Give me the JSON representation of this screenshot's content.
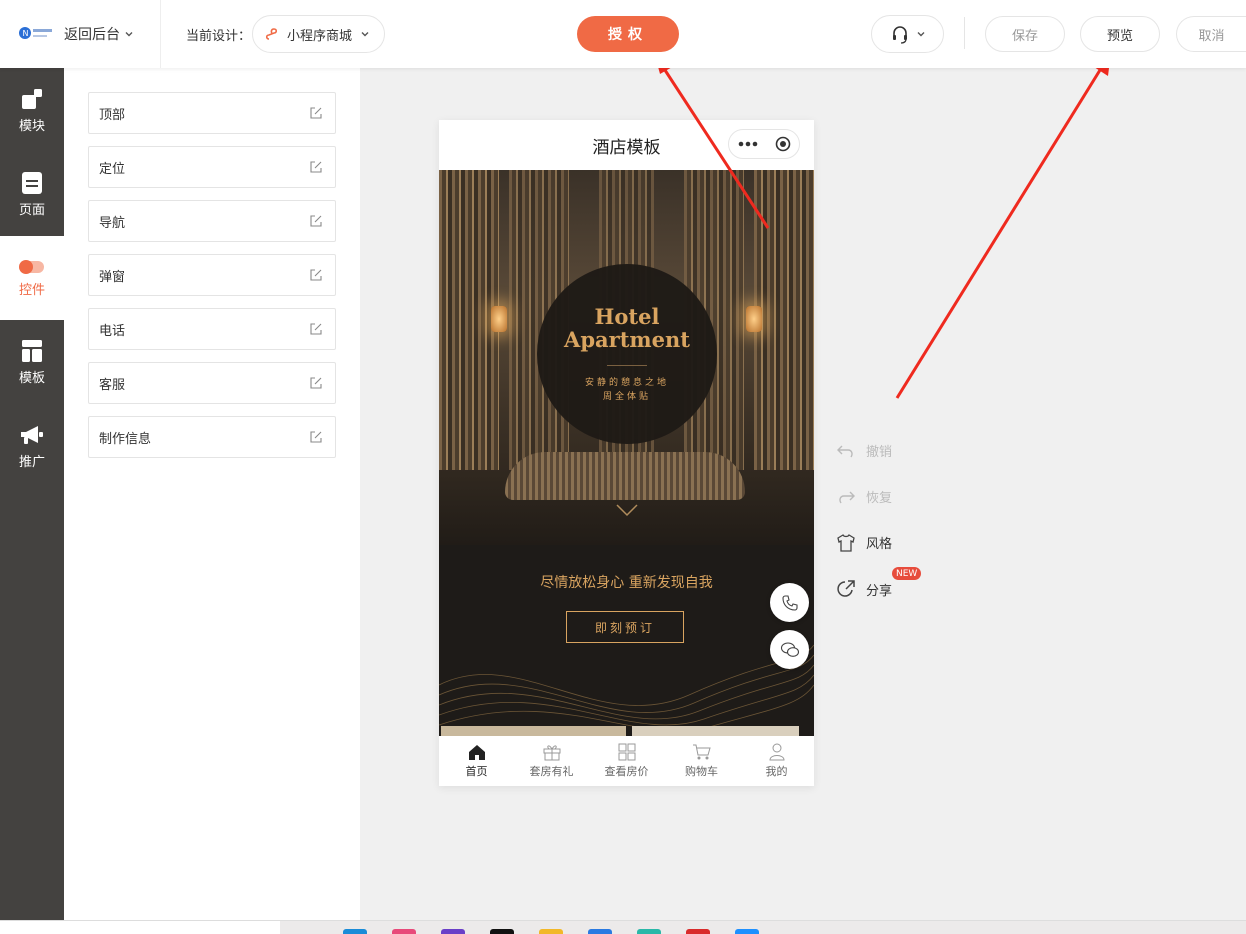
{
  "topbar": {
    "back_label": "返回后台",
    "current_design_label": "当前设计：",
    "design_name": "小程序商城",
    "auth_label": "授权",
    "save_label": "保存",
    "preview_label": "预览",
    "cancel_label": "取消"
  },
  "sidebar": {
    "items": [
      {
        "label": "模块"
      },
      {
        "label": "页面"
      },
      {
        "label": "控件"
      },
      {
        "label": "模板"
      },
      {
        "label": "推广"
      }
    ]
  },
  "controls": {
    "items": [
      {
        "label": "顶部"
      },
      {
        "label": "定位"
      },
      {
        "label": "导航"
      },
      {
        "label": "弹窗"
      },
      {
        "label": "电话"
      },
      {
        "label": "客服"
      },
      {
        "label": "制作信息"
      }
    ]
  },
  "phone": {
    "page_title": "酒店模板",
    "hero_title_line1": "Hotel",
    "hero_title_line2": "Apartment",
    "hero_sub_line1": "安静的憩息之地",
    "hero_sub_line2": "周全体贴",
    "slogan": "尽情放松身心 重新发现自我",
    "book_button": "即刻预订",
    "tabs": [
      {
        "label": "首页"
      },
      {
        "label": "套房有礼"
      },
      {
        "label": "查看房价"
      },
      {
        "label": "购物车"
      },
      {
        "label": "我的"
      }
    ]
  },
  "tools": {
    "undo_label": "撤销",
    "redo_label": "恢复",
    "style_label": "风格",
    "share_label": "分享",
    "new_badge": "NEW"
  },
  "colors": {
    "accent": "#f06a45",
    "sidebar_bg": "#444240",
    "gold": "#d9a460"
  }
}
